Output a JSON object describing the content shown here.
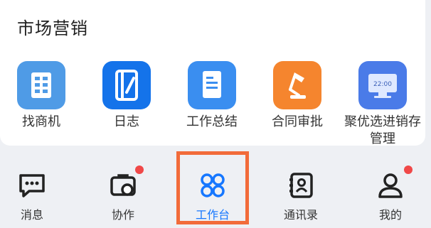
{
  "section": {
    "title": "市场营销"
  },
  "apps": [
    {
      "label": "找商机",
      "icon": "building-icon",
      "color": "#4a90e2"
    },
    {
      "label": "日志",
      "icon": "journal-icon",
      "color": "#1a73e8"
    },
    {
      "label": "工作总结",
      "icon": "document-icon",
      "color": "#3a8ef0"
    },
    {
      "label": "合同审批",
      "icon": "desk-lamp-icon",
      "color": "#f5852e"
    },
    {
      "label": "聚优选进销存管理",
      "icon": "monitor-clock-icon",
      "color": "#4a7be8",
      "monitor_time": "22:00"
    }
  ],
  "tabs": [
    {
      "label": "消息",
      "icon": "chat-icon",
      "badge": false
    },
    {
      "label": "协作",
      "icon": "briefcase-icon",
      "badge": true
    },
    {
      "label": "工作台",
      "icon": "grid-icon",
      "badge": false,
      "active": true
    },
    {
      "label": "通讯录",
      "icon": "contacts-icon",
      "badge": false
    },
    {
      "label": "我的",
      "icon": "person-icon",
      "badge": true
    }
  ],
  "colors": {
    "accent": "#1677ff",
    "badge": "#f04848",
    "highlight": "#f26b3a"
  }
}
